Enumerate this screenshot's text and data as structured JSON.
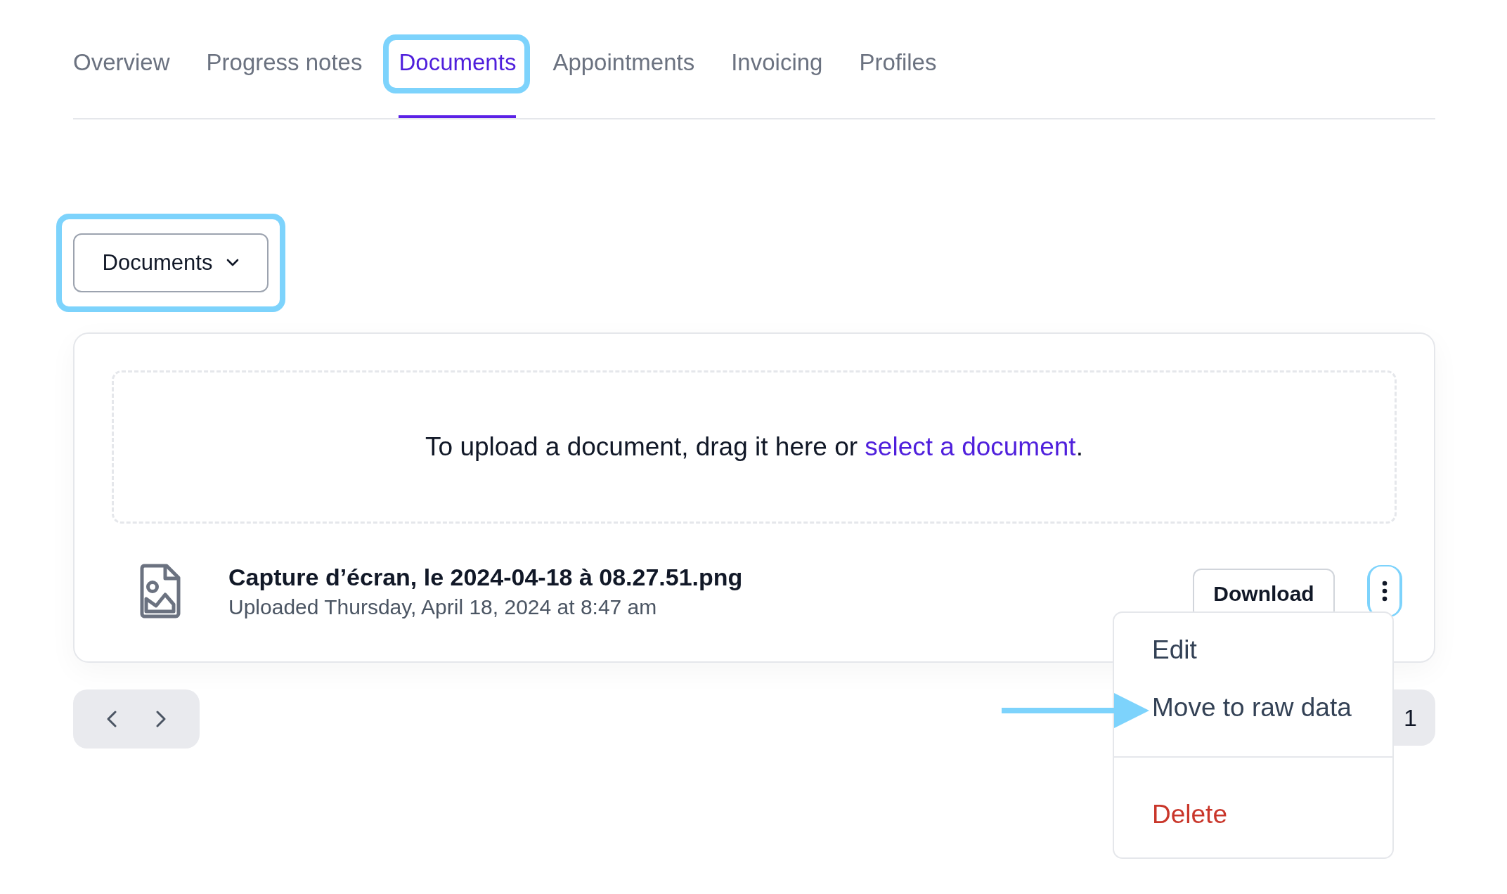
{
  "tabs": [
    {
      "label": "Overview",
      "selected": false,
      "highlighted": false
    },
    {
      "label": "Progress notes",
      "selected": false,
      "highlighted": false
    },
    {
      "label": "Documents",
      "selected": true,
      "highlighted": true
    },
    {
      "label": "Appointments",
      "selected": false,
      "highlighted": false
    },
    {
      "label": "Invoicing",
      "selected": false,
      "highlighted": false
    },
    {
      "label": "Profiles",
      "selected": false,
      "highlighted": false
    }
  ],
  "category_dropdown": {
    "value": "Documents",
    "highlighted": true
  },
  "upload_zone": {
    "text": "To upload a document, drag it here or ",
    "link": "select a document",
    "after": "."
  },
  "files": [
    {
      "name": "Capture d’écran, le 2024-04-18 à 08.27.51.png",
      "uploaded": "Uploaded Thursday, April 18, 2024 at 8:47 am",
      "download": "Download",
      "menu_highlighted": true
    }
  ],
  "menu": {
    "items": [
      {
        "label": "Edit",
        "kind": "normal",
        "pointed_at": false
      },
      {
        "label": "Move to raw data",
        "kind": "normal",
        "pointed_at": true
      },
      {
        "label": "Delete",
        "kind": "danger",
        "pointed_at": false
      }
    ]
  },
  "pagination": {
    "page": "1"
  }
}
